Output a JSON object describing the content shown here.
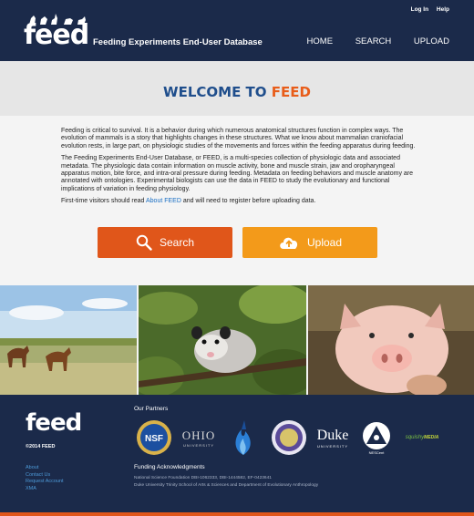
{
  "header": {
    "logo": "feed",
    "tagline": "Feeding Experiments End-User Database",
    "top_links": [
      "Log In",
      "Help"
    ],
    "nav": [
      "HOME",
      "SEARCH",
      "UPLOAD"
    ]
  },
  "welcome": {
    "prefix": "WELCOME TO ",
    "accent": "FEED"
  },
  "intro": {
    "p1": "Feeding is critical to survival. It is a behavior during which numerous anatomical structures function in complex ways. The evolution of mammals is a story that highlights changes in these structures. What we know about mammalian craniofacial evolution rests, in large part, on physiologic studies of the movements and forces within the feeding apparatus during feeding.",
    "p2": "The Feeding Experiments End-User Database, or FEED, is a multi-species collection of physiologic data and associated metadata. The physiologic data contain information on muscle activity, bone and muscle strain, jaw and oropharyngeal apparatus motion, bite force, and intra-oral pressure during feeding. Metadata on feeding behaviors and muscle anatomy are annotated with ontologies. Experimental biologists can use the data in FEED to study the evolutionary and functional implications of variation in feeding physiology.",
    "p3_before": "First-time visitors should read ",
    "p3_link": "About FEED",
    "p3_after": " and will need to register before uploading data."
  },
  "buttons": {
    "search": "Search",
    "upload": "Upload"
  },
  "footer": {
    "logo": "feed",
    "copyright": "©2014 FEED",
    "links": [
      "About",
      "Contact Us",
      "Request Account",
      "XMA"
    ],
    "partners_title": "Our Partners",
    "partners": {
      "nsf": "NSF",
      "ohio_main": "OHIO",
      "ohio_sub": "UNIVERSITY",
      "duke_main": "Duke",
      "duke_sub": "UNIVERSITY",
      "nescent": "NESCent",
      "squishy_a": "squishy",
      "squishy_b": "MEDIA"
    },
    "funding_title": "Funding Acknowledgments",
    "funding_lines": [
      "National Science Foundation DBI-1062333, DBI-1444582, EF-0423641",
      "Duke University Trinity School of Arts & Sciences and Department of Evolutionary Anthropology"
    ]
  },
  "colors": {
    "navy": "#1b2a4a",
    "orange": "#e0561a",
    "amber": "#f39a1a",
    "blue": "#1f4e8c"
  },
  "icons": [
    "search-icon",
    "upload-cloud-icon"
  ]
}
